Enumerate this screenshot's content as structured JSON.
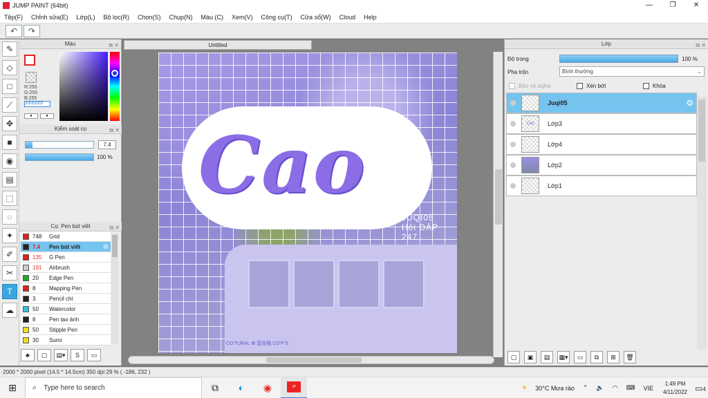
{
  "window": {
    "title": "JUMP PAINT (64bit)",
    "controls": [
      "—",
      "❐",
      "✕"
    ]
  },
  "menu": [
    "Tệp(F)",
    "Chỉnh sửa(E)",
    "Lớp(L)",
    "Bộ lọc(R)",
    "Chọn(S)",
    "Chụp(N)",
    "Màu (C)",
    "Xem(V)",
    "Công cụ(T)",
    "Cửa sổ(W)",
    "Cloud",
    "Help"
  ],
  "toolbar": {
    "undo": "↶",
    "redo": "↷"
  },
  "color_panel": {
    "title": "Màu",
    "r": "R:255",
    "g": "G:255",
    "b": "B:255",
    "hex": "FFFFFF"
  },
  "brush_control": {
    "title": "Kiểm soát cọ",
    "size": "7.4",
    "size_fraction": 0.1,
    "opacity": "100 %",
    "opacity_fraction": 1.0
  },
  "brush_panel": {
    "title": "Cọ: Pen bút viết",
    "items": [
      {
        "num": "748",
        "name": "Grid",
        "color": "#e02020",
        "red_num": false
      },
      {
        "num": "7.4",
        "name": "Pen bút viết",
        "color": "#222222",
        "red_num": true,
        "selected": true
      },
      {
        "num": "135",
        "name": "G Pen",
        "color": "#e02020",
        "red_num": true
      },
      {
        "num": "191",
        "name": "Airbrush",
        "color": "#cccccc",
        "red_num": true
      },
      {
        "num": "20",
        "name": "Edge Pen",
        "color": "#22aa22",
        "red_num": false
      },
      {
        "num": "8",
        "name": "Mapping Pen",
        "color": "#e02020",
        "red_num": false
      },
      {
        "num": "3",
        "name": "Pencil chì",
        "color": "#222222",
        "red_num": false
      },
      {
        "num": "50",
        "name": "Watercolor",
        "color": "#30c0e0",
        "red_num": false
      },
      {
        "num": "8",
        "name": "Pen tạo ảnh",
        "color": "#222222",
        "red_num": false
      },
      {
        "num": "50",
        "name": "Stipple Pen",
        "color": "#eedd22",
        "red_num": false
      },
      {
        "num": "30",
        "name": "Sumi",
        "color": "#eedd22",
        "red_num": false
      }
    ]
  },
  "canvas": {
    "tab": "Untitled",
    "art_text": "Cao",
    "sub1": "JUQI05",
    "sub2": "Hỏi ĐÁP 247",
    "watermark": "CO'TURAL  ✿ 蓝花楹 CO'P'S"
  },
  "layer_panel": {
    "title": "Lớp",
    "opacity_label": "Độ trong",
    "opacity_value": "100 %",
    "opacity_fraction": 1.0,
    "blend_label": "Pha trộn",
    "blend_value": "Bình thường",
    "protect_alpha": "Bảo vệ alpha",
    "clip": "Xén bớt",
    "lock": "Khóa",
    "layers": [
      {
        "name": "Juqi05",
        "selected": true,
        "thumb": ""
      },
      {
        "name": "Lớp3",
        "thumb": "Cao"
      },
      {
        "name": "Lớp4",
        "thumb": ""
      },
      {
        "name": "Lớp2",
        "thumb": "pic"
      },
      {
        "name": "Lớp1",
        "thumb": ""
      }
    ]
  },
  "status": "2000 * 2000 pixel   (14.5 * 14.5cm)   350 dpi   29 %   ( -186, 232 )",
  "taskbar": {
    "search_placeholder": "Type here to search",
    "weather": "30°C  Mưa rào",
    "lang": "VIE",
    "time": "1:49 PM",
    "date": "4/11/2022",
    "notif_count": "4"
  }
}
